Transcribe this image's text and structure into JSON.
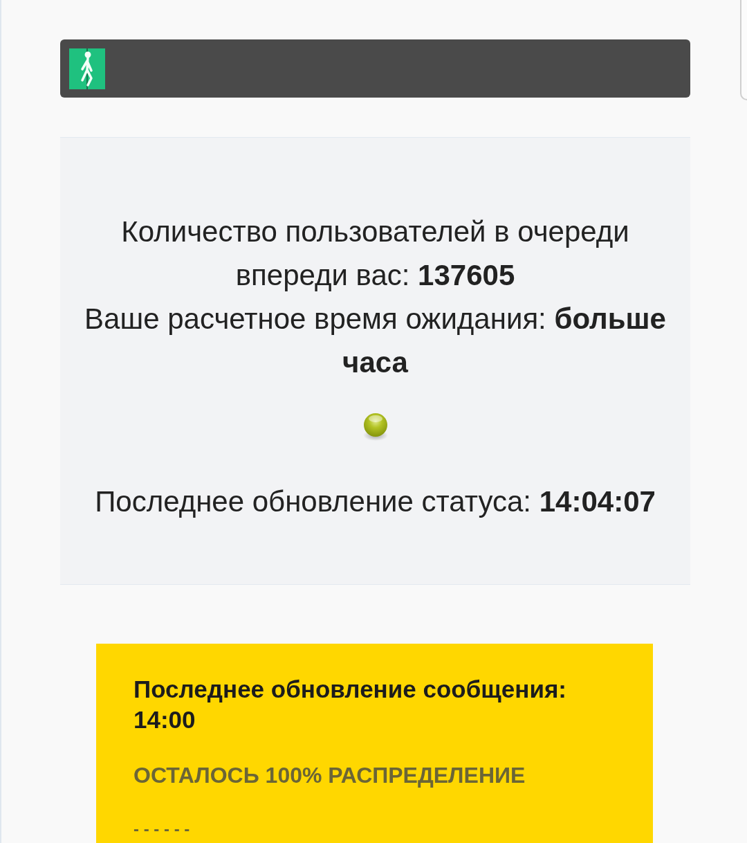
{
  "queue_panel": {
    "queue_text": "Количество пользователей в очереди впереди вас: **137605**",
    "wait_text": "Ваше расчетное время ожидания: **больше часа**",
    "status_update_text": "Последнее обновление статуса: **14:04:07**"
  },
  "message_box": {
    "title": "Последнее обновление сообщения: 14:00",
    "notice": "ОСТАЛОСЬ 100% РАСПРЕДЕЛЕНИЕ",
    "divider_text": "- - - - - -"
  }
}
